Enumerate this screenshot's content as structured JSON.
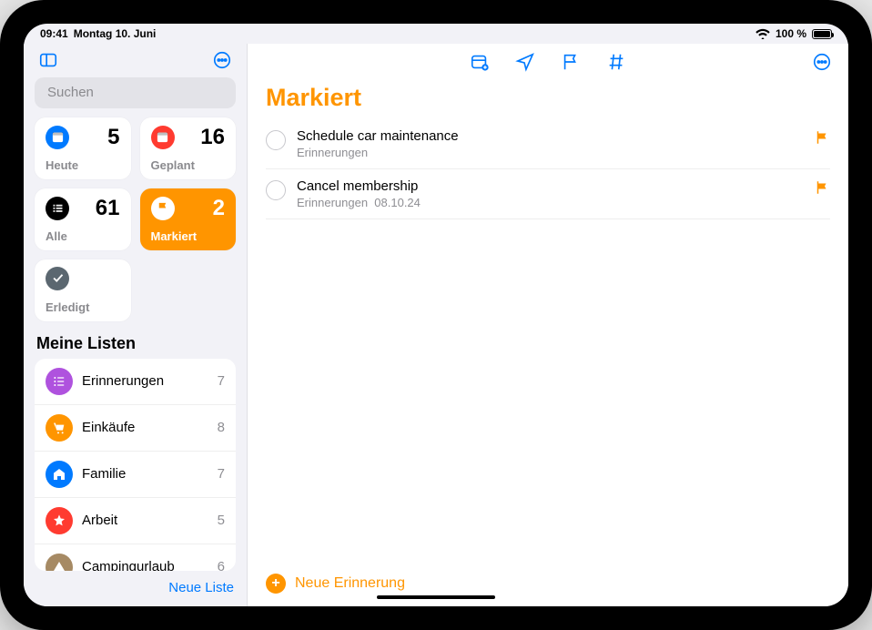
{
  "status": {
    "time": "09:41",
    "date": "Montag 10. Juni",
    "battery_pct": "100 %",
    "wifi": true
  },
  "sidebar": {
    "search_placeholder": "Suchen",
    "smart": [
      {
        "key": "today",
        "label": "Heute",
        "count": 5,
        "bg": "#007aff",
        "active": false
      },
      {
        "key": "scheduled",
        "label": "Geplant",
        "count": 16,
        "bg": "#ff3b30",
        "active": false
      },
      {
        "key": "all",
        "label": "Alle",
        "count": 61,
        "bg": "#000000",
        "active": false
      },
      {
        "key": "flagged",
        "label": "Markiert",
        "count": 2,
        "bg": "#ff9500",
        "active": true
      },
      {
        "key": "done",
        "label": "Erledigt",
        "count": "",
        "bg": "#5b6770",
        "active": false
      }
    ],
    "my_lists_title": "Meine Listen",
    "lists": [
      {
        "name": "Erinnerungen",
        "count": 7,
        "color": "#af52de"
      },
      {
        "name": "Einkäufe",
        "count": 8,
        "color": "#ff9500"
      },
      {
        "name": "Familie",
        "count": 7,
        "color": "#007aff"
      },
      {
        "name": "Arbeit",
        "count": 5,
        "color": "#ff3b30"
      },
      {
        "name": "Campingurlaub",
        "count": 6,
        "color": "#a68a64"
      }
    ],
    "new_list_label": "Neue Liste"
  },
  "main": {
    "title": "Markiert",
    "items": [
      {
        "title": "Schedule car maintenance",
        "list": "Erinnerungen",
        "date": ""
      },
      {
        "title": "Cancel membership",
        "list": "Erinnerungen",
        "date": "08.10.24"
      }
    ],
    "new_reminder_label": "Neue Erinnerung"
  },
  "colors": {
    "accent": "#007aff",
    "orange": "#ff9500"
  }
}
